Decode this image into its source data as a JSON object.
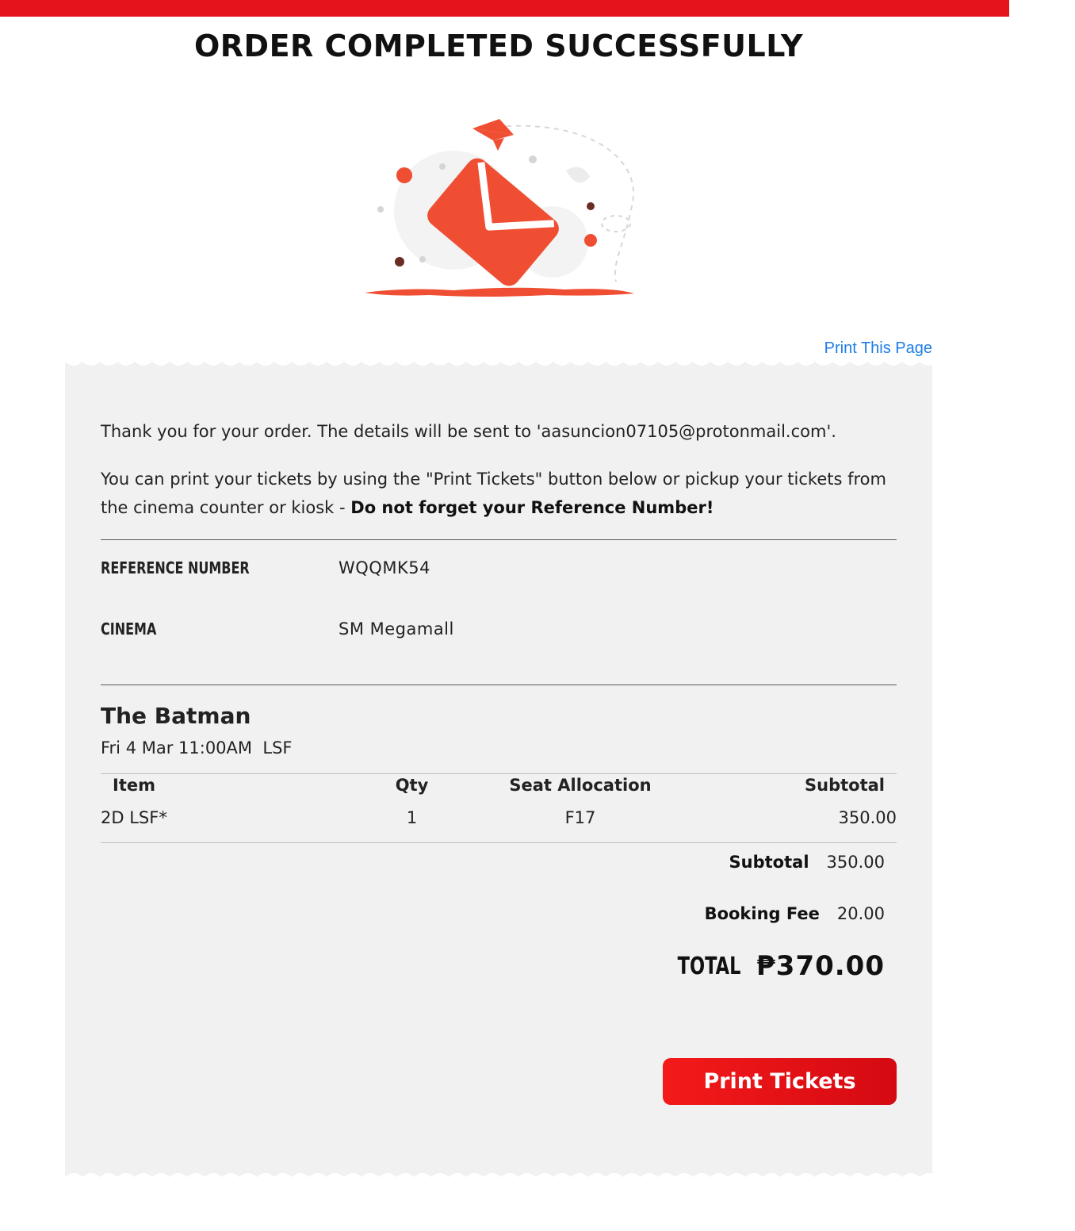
{
  "page": {
    "title": "ORDER COMPLETED SUCCESSFULLY",
    "print_page_link": "Print This Page",
    "accent_color": "#e4141b",
    "link_color": "#1f7de8"
  },
  "illustration": {
    "icon": "envelope-sent-icon"
  },
  "message": {
    "line1": "Thank you for your order. The details will be sent to 'aasuncion07105@protonmail.com'.",
    "line2_prefix": "You can print your tickets by using the \"Print Tickets\" button below or pickup your tickets from the cinema counter or kiosk - ",
    "line2_bold": "Do not forget your Reference Number!"
  },
  "booking": {
    "reference_label": "REFERENCE NUMBER",
    "reference_value": "WQQMK54",
    "cinema_label": "CINEMA",
    "cinema_value": "SM Megamall"
  },
  "movie": {
    "title": "The Batman",
    "showtime": "Fri 4 Mar 11:00AM  LSF"
  },
  "table": {
    "headers": {
      "item": "Item",
      "qty": "Qty",
      "seat": "Seat Allocation",
      "subtotal": "Subtotal"
    },
    "rows": [
      {
        "item": "2D LSF*",
        "qty": "1",
        "seat": "F17",
        "subtotal": "350.00"
      }
    ]
  },
  "totals": {
    "subtotal_label": "Subtotal",
    "subtotal_value": "350.00",
    "fee_label": "Booking Fee",
    "fee_value": "20.00",
    "total_label": "TOTAL",
    "total_value": "₱370.00"
  },
  "actions": {
    "print_tickets": "Print Tickets"
  }
}
